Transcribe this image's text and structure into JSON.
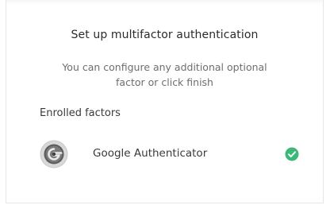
{
  "dialog": {
    "title": "Set up multifactor authentication",
    "subtitle_line1": "You can configure any additional optional",
    "subtitle_line2": "factor or click finish"
  },
  "enrolled": {
    "section_label": "Enrolled factors",
    "factors": [
      {
        "name": "Google Authenticator",
        "icon": "google-authenticator-icon",
        "status": "enrolled",
        "status_icon": "check-circle-icon",
        "status_color": "#3cb878"
      }
    ]
  }
}
